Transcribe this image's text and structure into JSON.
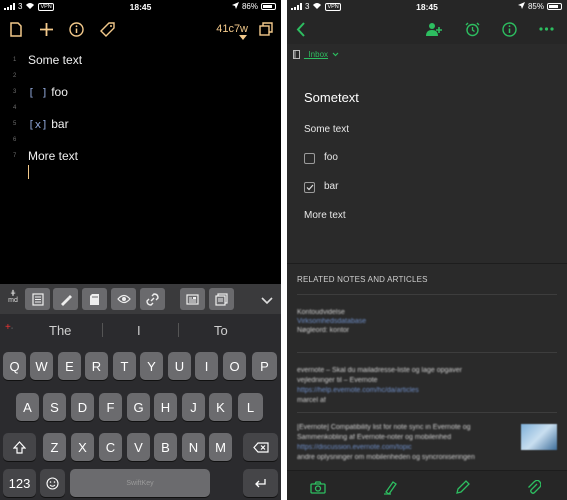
{
  "left_phone": {
    "status": {
      "carrier": "3",
      "vpn": "VPN",
      "time": "18:45",
      "battery": "86%",
      "battery_level": 0.86
    },
    "toolbar": {
      "commit": "41c7w"
    },
    "editor": {
      "lines": [
        {
          "num": "1",
          "text": "Some text",
          "kind": "text"
        },
        {
          "num": "2",
          "text": "",
          "kind": "text"
        },
        {
          "num": "3",
          "marker": "[ ]",
          "text": "foo",
          "kind": "todo"
        },
        {
          "num": "4",
          "text": "",
          "kind": "text"
        },
        {
          "num": "5",
          "marker": "[x]",
          "text": "bar",
          "kind": "todo"
        },
        {
          "num": "6",
          "text": "",
          "kind": "text"
        },
        {
          "num": "7",
          "text": "More text",
          "kind": "text"
        }
      ]
    },
    "accessory": {
      "md_top": "⋕",
      "md_bottom": "md"
    },
    "keyboard": {
      "predictions": [
        "The",
        "I",
        "To"
      ],
      "row1": [
        "Q",
        "W",
        "E",
        "R",
        "T",
        "Y",
        "U",
        "I",
        "O",
        "P"
      ],
      "row2": [
        "A",
        "S",
        "D",
        "F",
        "G",
        "H",
        "J",
        "K",
        "L"
      ],
      "row3": [
        "Z",
        "X",
        "C",
        "V",
        "B",
        "N",
        "M"
      ],
      "numbers_key": "123",
      "space_label": "SwiftKey"
    }
  },
  "right_phone": {
    "status": {
      "carrier": "3",
      "vpn": "VPN",
      "time": "18:45",
      "battery": "85%",
      "battery_level": 0.85
    },
    "notebook": "_Inbox",
    "note": {
      "title": "Sometext",
      "intro": "Some text",
      "items": [
        {
          "label": "foo",
          "checked": false
        },
        {
          "label": "bar",
          "checked": true
        }
      ],
      "outro": "More text"
    },
    "related": {
      "heading": "RELATED NOTES AND ARTICLES",
      "items": [
        {
          "lines": [
            "Kontoudvidelse",
            "Virksomhedsdatabase",
            "Nøgleord: kontor"
          ]
        },
        {
          "lines": [
            "evernote – Skal du mailadresse-liste og lage opgaver",
            "vejledninger til – Evernote",
            "https://help.evernote.com/hc/da/articles",
            "marcel af"
          ]
        },
        {
          "lines": [
            "[Evernote] Compatibility list for note sync in Evernote og",
            "Sammenkobling af Evernote-noter og mobilenhed",
            "https://discussion.evernote.com/topic",
            "andre oplysninger om mobilenheden og syncroniseringen"
          ]
        }
      ]
    }
  }
}
